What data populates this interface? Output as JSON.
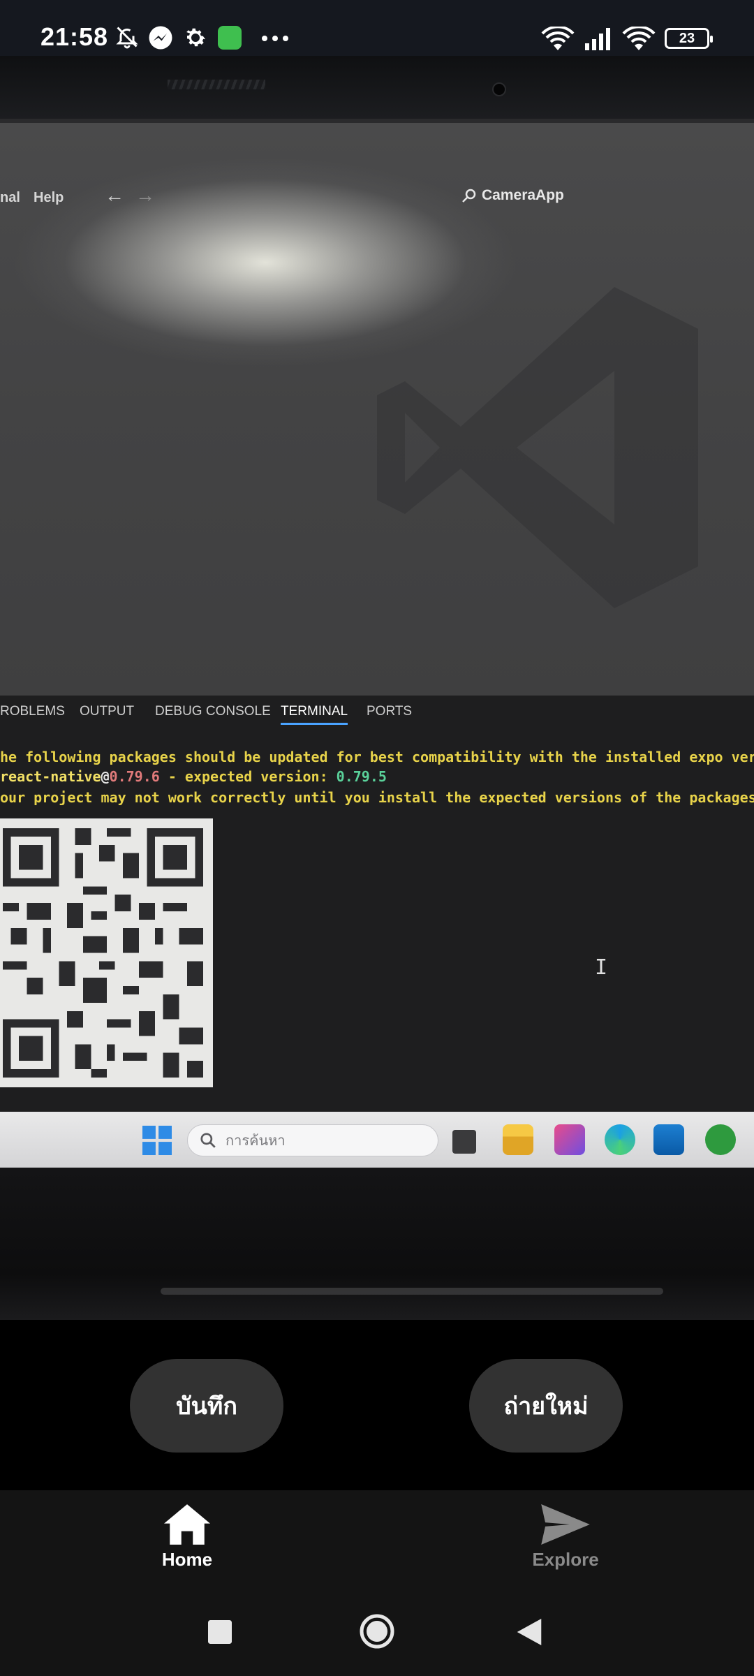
{
  "status_bar": {
    "time": "21:58",
    "battery": "23",
    "icons": [
      "bell-off-icon",
      "messenger-icon",
      "gear-icon",
      "app-icon",
      "more-icon",
      "wifi-icon",
      "signal-icon",
      "wifi-6-icon"
    ]
  },
  "preview": {
    "menu_items": [
      "nal",
      "Help"
    ],
    "command_center": "CameraApp",
    "panel_tabs": [
      "ROBLEMS",
      "OUTPUT",
      "DEBUG CONSOLE",
      "TERMINAL",
      "PORTS"
    ],
    "active_tab": "TERMINAL",
    "terminal": {
      "line1": "he following packages should be updated for best compatibility with the installed expo versi",
      "line2_pkg": " react-native",
      "line2_at": "@",
      "line2_ver": "0.79.6",
      "line2_mid": " - expected version: ",
      "line2_expected": "0.79.5",
      "line3": "our project may not work correctly until you install the expected versions of the packages."
    },
    "taskbar_search_placeholder": "การค้นหา"
  },
  "actions": {
    "save_label": "บันทึก",
    "retake_label": "ถ่ายใหม่"
  },
  "tabs": [
    {
      "label": "Home",
      "icon": "home-icon",
      "active": true
    },
    {
      "label": "Explore",
      "icon": "send-icon",
      "active": false
    }
  ]
}
